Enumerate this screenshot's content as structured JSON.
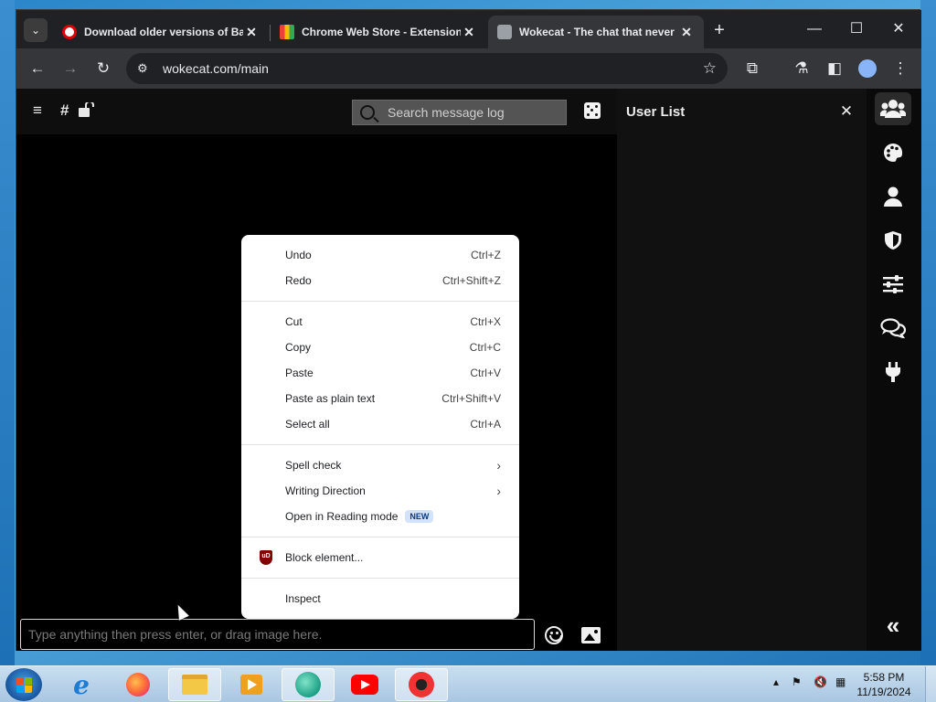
{
  "browser": {
    "tabs": [
      {
        "title": "Download older versions of Ba",
        "favicon": "opera-red-circle-icon",
        "active": false
      },
      {
        "title": "Chrome Web Store - Extensions",
        "favicon": "chrome-web-store-icon",
        "active": false
      },
      {
        "title": "Wokecat - The chat that never",
        "favicon": "wokecat-cat-icon",
        "active": true
      }
    ],
    "new_tab_label": "+",
    "url": "wokecat.com/main",
    "window_controls": {
      "minimize": "—",
      "maximize": "☐",
      "close": "✕"
    }
  },
  "app": {
    "header": {
      "menu_icon": "≡",
      "channel_icon": "#",
      "search_placeholder": "Search message log"
    },
    "userlist": {
      "title": "User List",
      "close_label": "✕"
    },
    "rail_items": [
      {
        "name": "users-icon",
        "selected": true
      },
      {
        "name": "palette-icon",
        "selected": false
      },
      {
        "name": "user-icon",
        "selected": false
      },
      {
        "name": "shield-icon",
        "selected": false
      },
      {
        "name": "sliders-icon",
        "selected": false
      },
      {
        "name": "chat-bubbles-icon",
        "selected": false
      },
      {
        "name": "plug-icon",
        "selected": false
      }
    ],
    "collapse_label": "«",
    "compose_placeholder": "Type anything then press enter, or drag image here."
  },
  "context_menu": {
    "groups": [
      [
        {
          "label": "Undo",
          "shortcut": "Ctrl+Z"
        },
        {
          "label": "Redo",
          "shortcut": "Ctrl+Shift+Z"
        }
      ],
      [
        {
          "label": "Cut",
          "shortcut": "Ctrl+X"
        },
        {
          "label": "Copy",
          "shortcut": "Ctrl+C"
        },
        {
          "label": "Paste",
          "shortcut": "Ctrl+V"
        },
        {
          "label": "Paste as plain text",
          "shortcut": "Ctrl+Shift+V"
        },
        {
          "label": "Select all",
          "shortcut": "Ctrl+A"
        }
      ],
      [
        {
          "label": "Spell check",
          "submenu": true
        },
        {
          "label": "Writing Direction",
          "submenu": true
        },
        {
          "label": "Open in Reading mode",
          "badge": "NEW"
        }
      ],
      [
        {
          "label": "Block element...",
          "icon": "ublock-origin-icon",
          "icon_text": "uD"
        }
      ],
      [
        {
          "label": "Inspect"
        }
      ]
    ]
  },
  "taskbar": {
    "apps": [
      "internet-explorer-icon",
      "firefox-icon",
      "file-explorer-icon",
      "media-player-icon",
      "chat-app-icon",
      "youtube-icon",
      "chrome-canary-icon"
    ],
    "time": "5:58 PM",
    "date": "11/19/2024"
  }
}
